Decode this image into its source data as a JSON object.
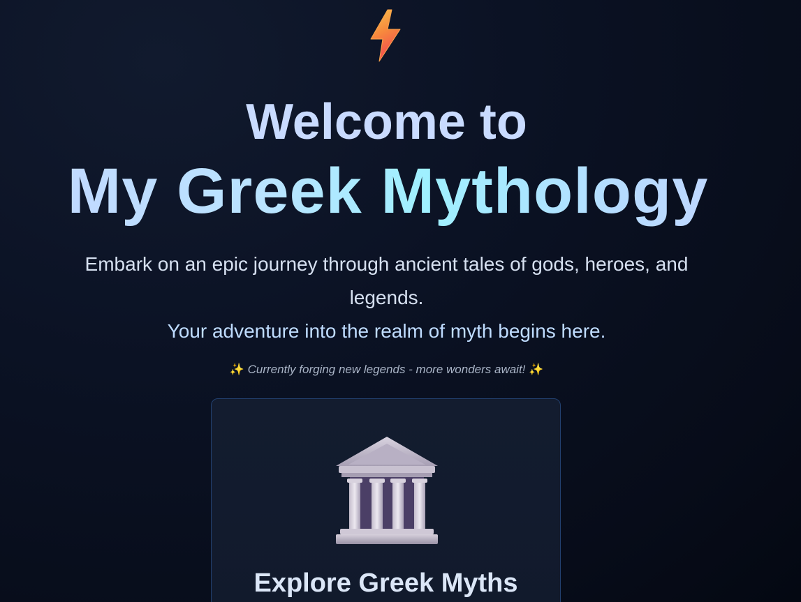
{
  "hero": {
    "welcome": "Welcome to",
    "title": "My Greek Mythology",
    "intro_line1": "Embark on an epic journey through ancient tales of gods, heroes, and legends.",
    "intro_line2": "Your adventure into the realm of myth begins here.",
    "status": "Currently forging new legends - more wonders await!",
    "sparkle": "✨"
  },
  "card": {
    "icon": "temple-icon",
    "title": "Explore Greek Myths"
  },
  "icons": {
    "logo": "lightning-bolt-icon"
  },
  "colors": {
    "background": "#0b1224",
    "title_gradient_start": "#c3d6ff",
    "title_gradient_mid": "#9ff0ff",
    "card_border": "#22406f",
    "bolt_top": "#f7c04a",
    "bolt_bottom": "#f2554a"
  }
}
